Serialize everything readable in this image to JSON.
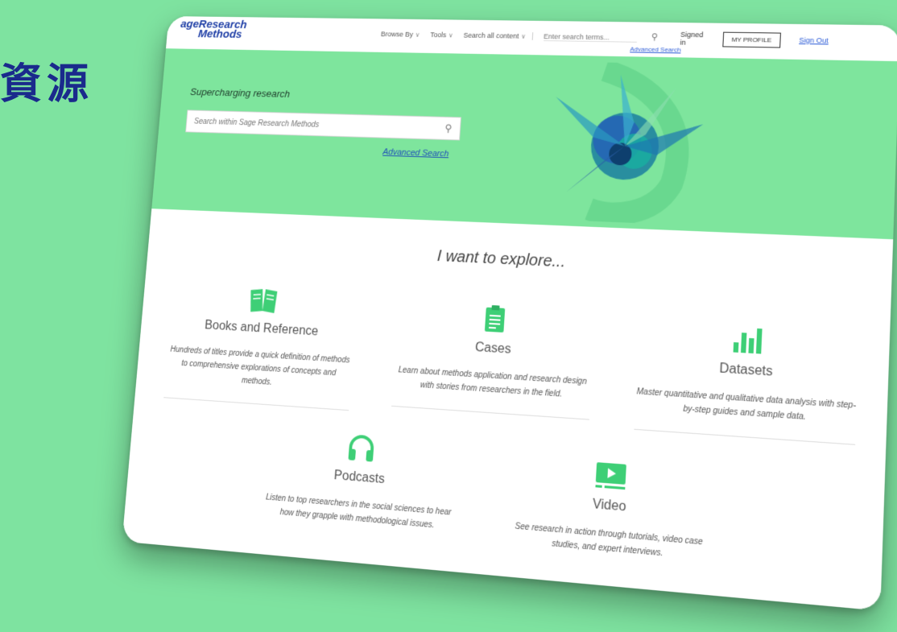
{
  "slide": {
    "title": "資源"
  },
  "nav": {
    "logo_line1": "ageResearch",
    "logo_line2": "Methods",
    "browse_by": "Browse By",
    "tools": "Tools",
    "search_scope": "Search all content",
    "search_placeholder": "Enter search terms...",
    "advanced_search": "Advanced Search",
    "signed_in": "Signed",
    "signed_in_sub": "in",
    "my_profile": "MY PROFILE",
    "sign_out": "Sign Out"
  },
  "hero": {
    "tagline": "Supercharging research",
    "search_placeholder": "Search within Sage Research Methods",
    "advanced_search": "Advanced Search"
  },
  "explore": {
    "title": "I want to explore...",
    "cards": [
      {
        "icon": "book-icon",
        "title": "Books and Reference",
        "desc": "Hundreds of titles provide a quick definition of methods to comprehensive explorations of concepts and methods."
      },
      {
        "icon": "clipboard-icon",
        "title": "Cases",
        "desc": "Learn about methods application and research design with stories from researchers in the field."
      },
      {
        "icon": "bar-chart-icon",
        "title": "Datasets",
        "desc": "Master quantitative and qualitative data analysis with step-by-step guides and sample data."
      },
      {
        "icon": "headphones-icon",
        "title": "Podcasts",
        "desc": "Listen to top researchers in the social sciences to hear how they grapple with methodological issues."
      },
      {
        "icon": "video-icon",
        "title": "Video",
        "desc": "See research in action through tutorials, video case studies, and expert interviews."
      }
    ]
  },
  "colors": {
    "background": "#7ee3a0",
    "hero": "#7ee59d",
    "icon_green": "#3ecf76",
    "link_blue": "#2b5bd7",
    "title_navy": "#1a2a8c"
  }
}
